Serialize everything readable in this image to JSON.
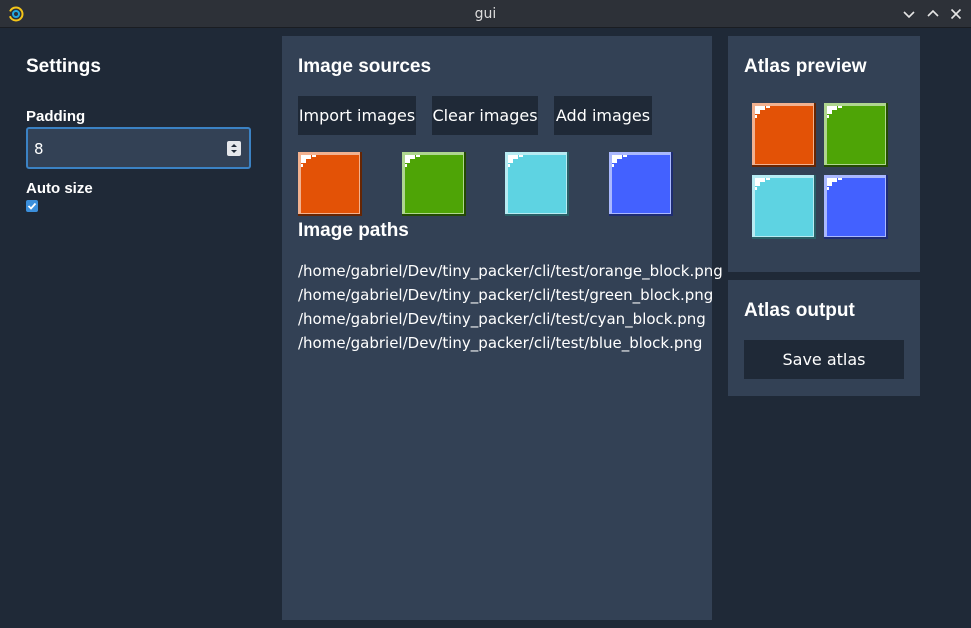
{
  "window": {
    "title": "gui"
  },
  "settings": {
    "title": "Settings",
    "padding_label": "Padding",
    "padding_value": "8",
    "auto_size_label": "Auto size",
    "auto_size_checked": true
  },
  "sources": {
    "title": "Image sources",
    "buttons": {
      "import": "Import images",
      "clear": "Clear images",
      "add": "Add images"
    },
    "thumbnails": [
      {
        "name": "orange_block",
        "color": "#e35206"
      },
      {
        "name": "green_block",
        "color": "#4ea406"
      },
      {
        "name": "cyan_block",
        "color": "#5ed3e2"
      },
      {
        "name": "blue_block",
        "color": "#4361ff"
      }
    ],
    "paths_title": "Image paths",
    "paths": [
      "/home/gabriel/Dev/tiny_packer/cli/test/orange_block.png",
      "/home/gabriel/Dev/tiny_packer/cli/test/green_block.png",
      "/home/gabriel/Dev/tiny_packer/cli/test/cyan_block.png",
      "/home/gabriel/Dev/tiny_packer/cli/test/blue_block.png"
    ]
  },
  "preview": {
    "title": "Atlas preview"
  },
  "output": {
    "title": "Atlas output",
    "save_label": "Save atlas"
  },
  "colors": {
    "background": "#1f2937",
    "panel": "#334155",
    "accent": "#3b8fdc",
    "titlebar": "#2d3138"
  }
}
